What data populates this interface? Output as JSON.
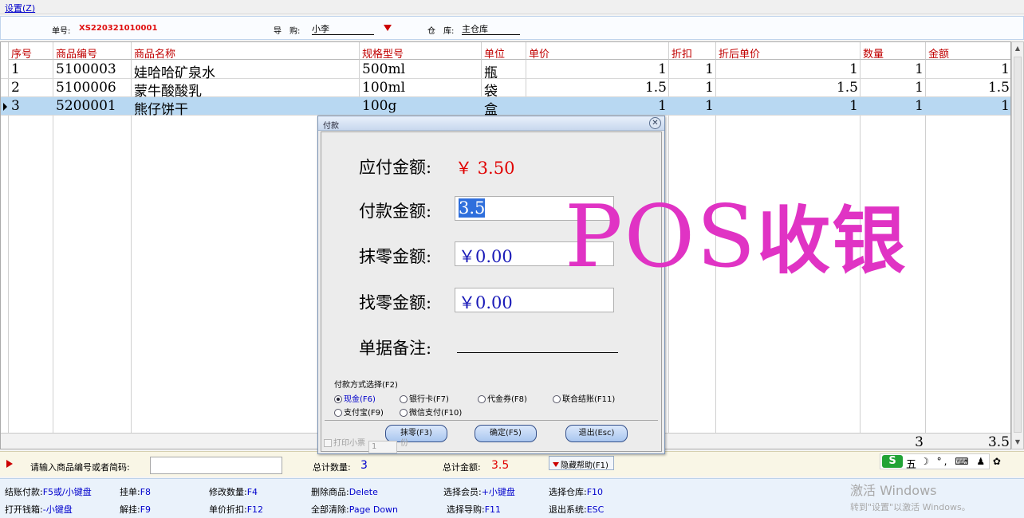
{
  "menu": {
    "settings": "设置(Z)"
  },
  "header": {
    "bill_no_label": "单号:",
    "bill_no": "XS220321010001",
    "guide_label": "导　购:",
    "guide_value": "小李",
    "warehouse_label": "仓　库:",
    "warehouse_value": "主仓库"
  },
  "grid": {
    "columns": [
      "序号",
      "商品编号",
      "商品名称",
      "规格型号",
      "单位",
      "单价",
      "折扣",
      "折后单价",
      "数量",
      "金额"
    ],
    "rows": [
      {
        "no": "1",
        "code": "5100003",
        "name": "娃哈哈矿泉水",
        "spec": "500ml",
        "unit": "瓶",
        "price": "1",
        "discount": "1",
        "disc_price": "1",
        "qty": "1",
        "amount": "1"
      },
      {
        "no": "2",
        "code": "5100006",
        "name": "蒙牛酸酸乳",
        "spec": "100ml",
        "unit": "袋",
        "price": "1.5",
        "discount": "1",
        "disc_price": "1.5",
        "qty": "1",
        "amount": "1.5"
      },
      {
        "no": "3",
        "code": "5200001",
        "name": "熊仔饼干",
        "spec": "100g",
        "unit": "盒",
        "price": "1",
        "discount": "1",
        "disc_price": "1",
        "qty": "1",
        "amount": "1"
      }
    ],
    "totals": {
      "qty": "3",
      "amount": "3.5"
    }
  },
  "input_bar": {
    "prompt": "请输入商品编号或者简码:",
    "total_qty_label": "总计数量:",
    "total_qty": "3",
    "total_amount_label": "总计金额:",
    "total_amount": "3.5",
    "hide_help": "隐藏帮助(F1)"
  },
  "dialog": {
    "title": "付款",
    "due_label": "应付金额:",
    "due_value": "￥ 3.50",
    "pay_label": "付款金额:",
    "pay_value": "3.5",
    "round_label": "抹零金额:",
    "round_value": "￥0.00",
    "change_label": "找零金额:",
    "change_value": "￥0.00",
    "remark_label": "单据备注:",
    "pay_method_title": "付款方式选择(F2)",
    "methods": [
      "现金(F6)",
      "银行卡(F7)",
      "代金券(F8)",
      "联合结账(F11)",
      "支付宝(F9)",
      "微信支付(F10)"
    ],
    "selected_method": "现金(F6)",
    "buttons": {
      "round": "抹零(F3)",
      "ok": "确定(F5)",
      "exit": "退出(Esc)"
    },
    "print_label": "打印小票",
    "print_copies": "1",
    "print_unit": "份"
  },
  "fkeys": [
    {
      "k": "结账付款:",
      "v": "F5或/小键盘"
    },
    {
      "k": "挂单:",
      "v": "F8"
    },
    {
      "k": "修改数量:",
      "v": "F4"
    },
    {
      "k": "删除商品:",
      "v": "Delete"
    },
    {
      "k": "选择会员:",
      "v": "+小键盘"
    },
    {
      "k": "选择仓库:",
      "v": "F10"
    },
    {
      "k": "打开钱箱:",
      "v": "-小键盘"
    },
    {
      "k": "解挂:",
      "v": "F9"
    },
    {
      "k": "单价折扣:",
      "v": "F12"
    },
    {
      "k": "全部清除:",
      "v": "Page Down"
    },
    {
      "k": "选择导购:",
      "v": "F11"
    },
    {
      "k": "退出系统:",
      "v": "ESC"
    }
  ],
  "watermark": {
    "latin": "POS",
    "cjk": "收银"
  },
  "windows": {
    "activate": "激活 Windows",
    "hint": "转到\"设置\"以激活 Windows。"
  },
  "ime": {
    "logo": "S",
    "mode": "五",
    "icons": "☽ °, ⌨ ♟ ✿"
  },
  "colors": {
    "header_text": "#c00000",
    "selected_row": "#b8d8f2",
    "link_blue": "#0000cc",
    "watermark": "#e033c4"
  }
}
